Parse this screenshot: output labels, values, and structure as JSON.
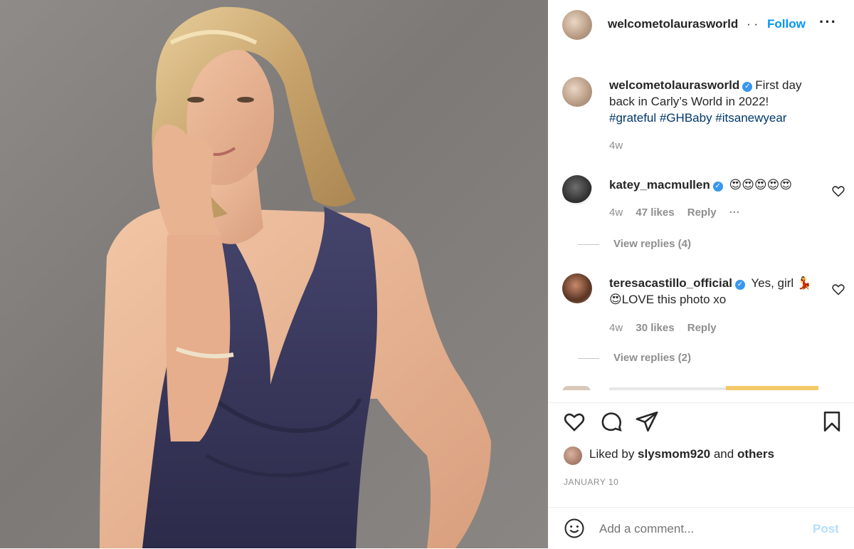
{
  "header": {
    "username": "welcometolaurasworld",
    "dot": "· ·",
    "follow_label": "Follow",
    "more_label": "···"
  },
  "caption": {
    "username": "welcometolaurasworld",
    "text": "First day back in Carly’s World in 2022!",
    "hashtags": "#grateful #GHBaby #itsanewyear",
    "time": "4w"
  },
  "comments": [
    {
      "username": "katey_macmullen",
      "text": "😍😍😍😍😍",
      "time": "4w",
      "likes": "47 likes",
      "reply_label": "Reply",
      "more_label": "···",
      "view_replies": "View replies (4)"
    },
    {
      "username": "teresacastillo_official",
      "text": "Yes, girl 💃😍LOVE this photo xo",
      "time": "4w",
      "likes": "30 likes",
      "reply_label": "Reply",
      "view_replies": "View replies (2)"
    }
  ],
  "likes": {
    "prefix": "Liked by ",
    "user": "slysmom920",
    "middle": " and ",
    "others": "others"
  },
  "date": "JANUARY 10",
  "add_comment": {
    "placeholder": "Add a comment...",
    "post_label": "Post"
  },
  "icons": {
    "heart": "heart-icon",
    "comment": "comment-icon",
    "share": "paper-plane-icon",
    "save": "bookmark-icon",
    "emoji": "smile-icon"
  },
  "colors": {
    "accent": "#0095f6",
    "verified": "#3897f0",
    "muted": "#8e8e8e",
    "dress": "#3b3a5e",
    "background": "#857f7c"
  }
}
